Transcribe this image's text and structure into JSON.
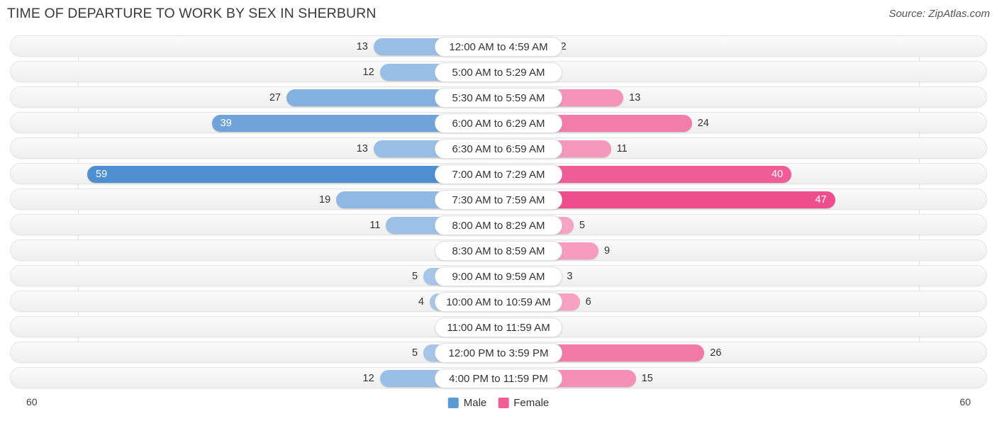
{
  "header": {
    "title": "TIME OF DEPARTURE TO WORK BY SEX IN SHERBURN",
    "source": "Source: ZipAtlas.com"
  },
  "axis": {
    "left_tick": "60",
    "right_tick": "60"
  },
  "legend": {
    "items": [
      {
        "label": "Male",
        "color": "#5b9bd5"
      },
      {
        "label": "Female",
        "color": "#ef5f96"
      }
    ]
  },
  "colors": {
    "male_max": "#4e8fd1",
    "male_min": "#aecbeb",
    "female_max": "#ee4e8c",
    "female_min": "#f9aec9",
    "row_background": "#f4f4f4",
    "row_border": "#e4e4e4",
    "label_pill": "#ffffff"
  },
  "chart_data": {
    "type": "bar",
    "orientation": "horizontal",
    "style": "diverging-bidirectional",
    "title": "TIME OF DEPARTURE TO WORK BY SEX IN SHERBURN",
    "xlabel": "",
    "ylabel": "",
    "xlim": [
      -60,
      60
    ],
    "axis_ticks": [
      "60",
      "60"
    ],
    "grid": false,
    "legend_position": "bottom-center",
    "categories": [
      "12:00 AM to 4:59 AM",
      "5:00 AM to 5:29 AM",
      "5:30 AM to 5:59 AM",
      "6:00 AM to 6:29 AM",
      "6:30 AM to 6:59 AM",
      "7:00 AM to 7:29 AM",
      "7:30 AM to 7:59 AM",
      "8:00 AM to 8:29 AM",
      "8:30 AM to 8:59 AM",
      "9:00 AM to 9:59 AM",
      "10:00 AM to 10:59 AM",
      "11:00 AM to 11:59 AM",
      "12:00 PM to 3:59 PM",
      "4:00 PM to 11:59 PM"
    ],
    "series": [
      {
        "name": "Male",
        "color": "#5b9bd5",
        "values": [
          13,
          12,
          27,
          39,
          13,
          59,
          19,
          11,
          0,
          5,
          4,
          1,
          5,
          12
        ]
      },
      {
        "name": "Female",
        "color": "#ef5f96",
        "values": [
          2,
          0,
          13,
          24,
          11,
          40,
          47,
          5,
          9,
          3,
          6,
          0,
          26,
          15
        ]
      }
    ]
  },
  "rows": [
    {
      "label": "12:00 AM to 4:59 AM",
      "male": "13",
      "female": "2"
    },
    {
      "label": "5:00 AM to 5:29 AM",
      "male": "12",
      "female": "0"
    },
    {
      "label": "5:30 AM to 5:59 AM",
      "male": "27",
      "female": "13"
    },
    {
      "label": "6:00 AM to 6:29 AM",
      "male": "39",
      "female": "24"
    },
    {
      "label": "6:30 AM to 6:59 AM",
      "male": "13",
      "female": "11"
    },
    {
      "label": "7:00 AM to 7:29 AM",
      "male": "59",
      "female": "40"
    },
    {
      "label": "7:30 AM to 7:59 AM",
      "male": "19",
      "female": "47"
    },
    {
      "label": "8:00 AM to 8:29 AM",
      "male": "11",
      "female": "5"
    },
    {
      "label": "8:30 AM to 8:59 AM",
      "male": "0",
      "female": "9"
    },
    {
      "label": "9:00 AM to 9:59 AM",
      "male": "5",
      "female": "3"
    },
    {
      "label": "10:00 AM to 10:59 AM",
      "male": "4",
      "female": "6"
    },
    {
      "label": "11:00 AM to 11:59 AM",
      "male": "1",
      "female": "0"
    },
    {
      "label": "12:00 PM to 3:59 PM",
      "male": "5",
      "female": "26"
    },
    {
      "label": "4:00 PM to 11:59 PM",
      "male": "12",
      "female": "15"
    }
  ]
}
